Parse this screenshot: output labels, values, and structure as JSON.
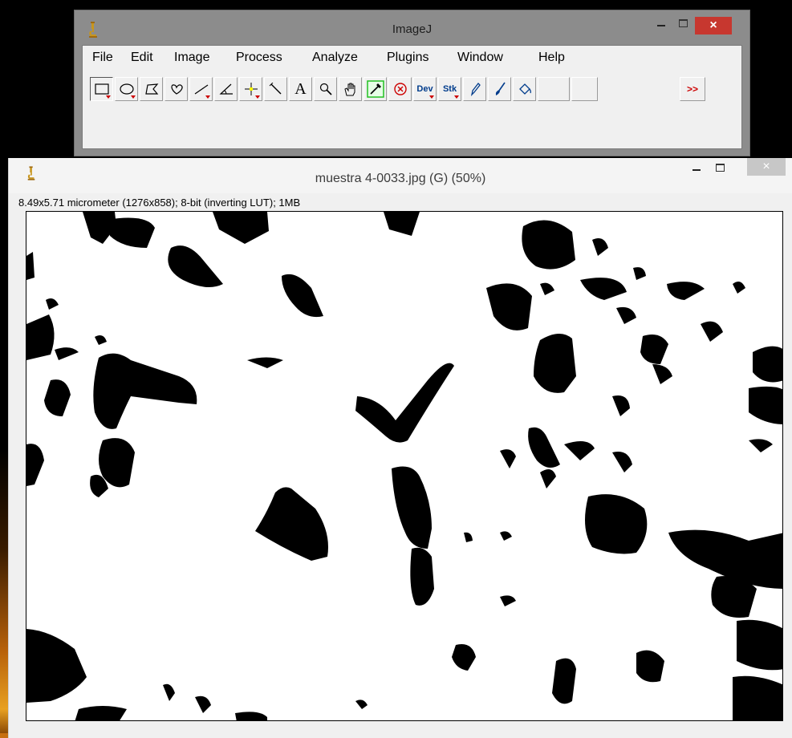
{
  "toolbar_window": {
    "title": "ImageJ",
    "close_symbol": "×",
    "menu": [
      "File",
      "Edit",
      "Image",
      "Process",
      "Analyze",
      "Plugins",
      "Window",
      "Help"
    ],
    "tools": [
      {
        "name": "rectangle-tool",
        "icon": "rectangle",
        "has_menu": true,
        "selected": true
      },
      {
        "name": "oval-tool",
        "icon": "oval",
        "has_menu": true
      },
      {
        "name": "polygon-tool",
        "icon": "polygon"
      },
      {
        "name": "freehand-tool",
        "icon": "freehand"
      },
      {
        "name": "line-tool",
        "icon": "line",
        "has_menu": true
      },
      {
        "name": "angle-tool",
        "icon": "angle"
      },
      {
        "name": "point-tool",
        "icon": "point",
        "has_menu": true
      },
      {
        "name": "wand-tool",
        "icon": "wand"
      },
      {
        "name": "text-tool",
        "icon": "text",
        "label": "A"
      },
      {
        "name": "magnifier-tool",
        "icon": "magnifier"
      },
      {
        "name": "scroll-tool",
        "icon": "hand"
      },
      {
        "name": "color-picker-tool",
        "icon": "dropper"
      },
      {
        "name": "remove-overlay-tool",
        "icon": "circle-x"
      },
      {
        "name": "developer-menu-tool",
        "icon": "dev",
        "label": "Dev",
        "has_menu": true
      },
      {
        "name": "stack-menu-tool",
        "icon": "stk",
        "label": "Stk",
        "has_menu": true
      },
      {
        "name": "pencil-tool",
        "icon": "pencil"
      },
      {
        "name": "brush-tool",
        "icon": "brush"
      },
      {
        "name": "flood-fill-tool",
        "icon": "fill"
      },
      {
        "name": "empty-slot-1",
        "icon": "empty"
      },
      {
        "name": "empty-slot-2",
        "icon": "empty"
      },
      {
        "name": "more-tools-button",
        "icon": "more",
        "label": ">>"
      }
    ]
  },
  "image_window": {
    "title": "muestra 4-0033.jpg (G) (50%)",
    "close_symbol": "×",
    "info": "8.49x5.71 micrometer (1276x858); 8-bit (inverting LUT); 1MB"
  },
  "colors": {
    "toolbar_frame": "#8c8c8c",
    "close_red": "#c7372f",
    "blob": "#000000",
    "canvas_bg": "#ffffff"
  }
}
